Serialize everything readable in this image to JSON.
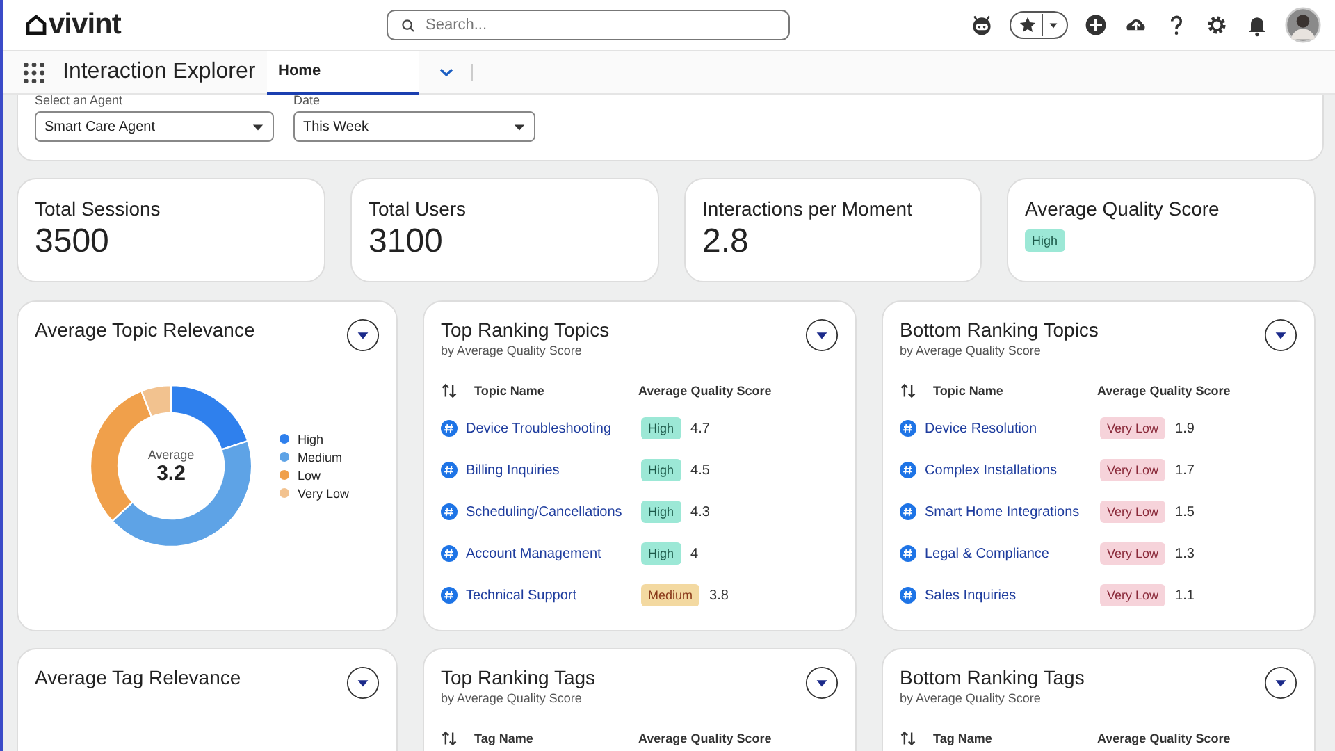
{
  "header": {
    "logo": "vivint",
    "search": {
      "placeholder": "Search..."
    }
  },
  "nav": {
    "app_name": "Interaction Explorer",
    "tabs": [
      {
        "label": "Home",
        "selected": true
      }
    ]
  },
  "filters": [
    {
      "label": "Select an Agent",
      "value": "Smart Care Agent"
    },
    {
      "label": "Date",
      "value": "This Week"
    }
  ],
  "stats": [
    {
      "label": "Total Sessions",
      "value": "3500",
      "kind": "number"
    },
    {
      "label": "Total Users",
      "value": "3100",
      "kind": "number"
    },
    {
      "label": "Interactions per Moment",
      "value": "2.8",
      "kind": "number"
    },
    {
      "label": "Average Quality Score",
      "value": "High",
      "kind": "badge"
    }
  ],
  "relevance_card": {
    "title": "Average Topic Relevance",
    "center_label": "Average",
    "center_value": "3.2",
    "legend": [
      {
        "label": "High",
        "color": "#2f80ed"
      },
      {
        "label": "Medium",
        "color": "#5ea3e6"
      },
      {
        "label": "Low",
        "color": "#f0a04b"
      },
      {
        "label": "Very Low",
        "color": "#f2c28f"
      }
    ]
  },
  "ranking_cards": [
    {
      "title": "Top Ranking Topics",
      "subtitle": "by Average Quality Score",
      "columns": [
        "Topic Name",
        "Average Quality Score"
      ],
      "rows": [
        {
          "name": "Device Troubleshooting",
          "badge": "High",
          "kind": "high",
          "score": "4.7"
        },
        {
          "name": "Billing Inquiries",
          "badge": "High",
          "kind": "high",
          "score": "4.5"
        },
        {
          "name": "Scheduling/Cancellations",
          "badge": "High",
          "kind": "high",
          "score": "4.3"
        },
        {
          "name": "Account Management",
          "badge": "High",
          "kind": "high",
          "score": "4"
        },
        {
          "name": "Technical Support",
          "badge": "Medium",
          "kind": "medium",
          "score": "3.8"
        }
      ]
    },
    {
      "title": "Bottom Ranking Topics",
      "subtitle": "by Average Quality Score",
      "columns": [
        "Topic Name",
        "Average Quality Score"
      ],
      "rows": [
        {
          "name": "Device Resolution",
          "badge": "Very Low",
          "kind": "very_low",
          "score": "1.9"
        },
        {
          "name": "Complex Installations",
          "badge": "Very Low",
          "kind": "very_low",
          "score": "1.7"
        },
        {
          "name": "Smart Home Integrations",
          "badge": "Very Low",
          "kind": "very_low",
          "score": "1.5"
        },
        {
          "name": "Legal & Compliance",
          "badge": "Very Low",
          "kind": "very_low",
          "score": "1.3"
        },
        {
          "name": "Sales Inquiries",
          "badge": "Very Low",
          "kind": "very_low",
          "score": "1.1"
        }
      ]
    }
  ],
  "lower_cards": [
    {
      "title": "Average Tag Relevance"
    },
    {
      "title": "Top Ranking Tags",
      "subtitle": "by Average Quality Score",
      "columns": [
        "Tag Name",
        "Average Quality Score"
      ]
    },
    {
      "title": "Bottom Ranking Tags",
      "subtitle": "by Average Quality Score",
      "columns": [
        "Tag Name",
        "Average Quality Score"
      ]
    }
  ]
}
